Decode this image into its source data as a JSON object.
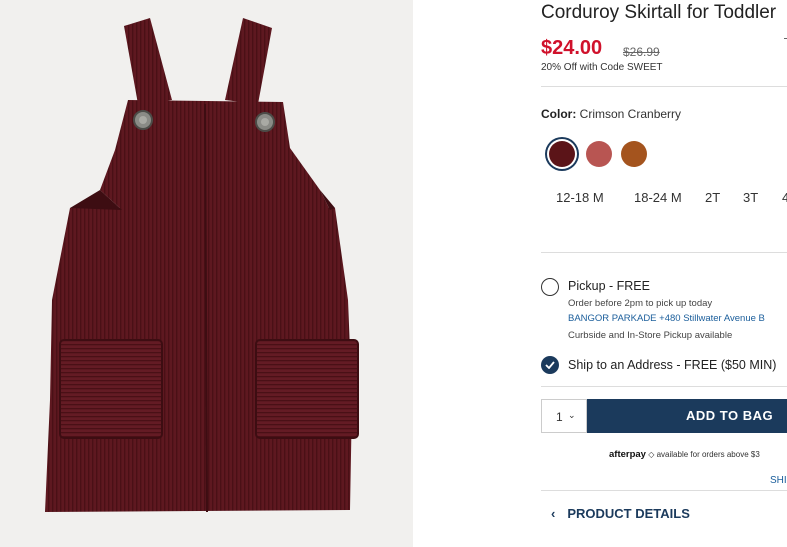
{
  "product": {
    "title": "Corduroy Skirtall for Toddler",
    "price": "$24.00",
    "original_price": "$26.99",
    "promo": "20% Off with Code SWEET",
    "color_label": "Color:",
    "color_value": "Crimson Cranberry",
    "swatches": [
      {
        "name": "Crimson Cranberry",
        "hex": "#5b1418",
        "selected": true
      },
      {
        "name": "Rose",
        "hex": "#b85552",
        "selected": false
      },
      {
        "name": "Rust",
        "hex": "#a4541e",
        "selected": false
      }
    ],
    "sizes": [
      "12-18 M",
      "18-24 M",
      "2T",
      "3T",
      "4"
    ]
  },
  "fulfillment": {
    "pickup_label": "Pickup - FREE",
    "pickup_note": "Order before 2pm to pick up today",
    "store": "BANGOR PARKADE +480 Stillwater Avenue  B",
    "pickup_options": "Curbside and In-Store Pickup available",
    "ship_label": "Ship to an Address - FREE ($50 MIN)"
  },
  "cart": {
    "quantity": "1",
    "add_label": "ADD TO BAG"
  },
  "afterpay": {
    "logo": "afterpay",
    "text": "available for orders above $3"
  },
  "links": {
    "ship": "SHI",
    "details": "PRODUCT DETAILS"
  },
  "colors": {
    "accent": "#1b3a5c",
    "price_red": "#d0112b",
    "garment": "#5e1820"
  },
  "icons": {
    "qty_chevron": "chevron-down-icon",
    "details_chevron": "chevron-left-icon",
    "checked": "check-icon"
  }
}
